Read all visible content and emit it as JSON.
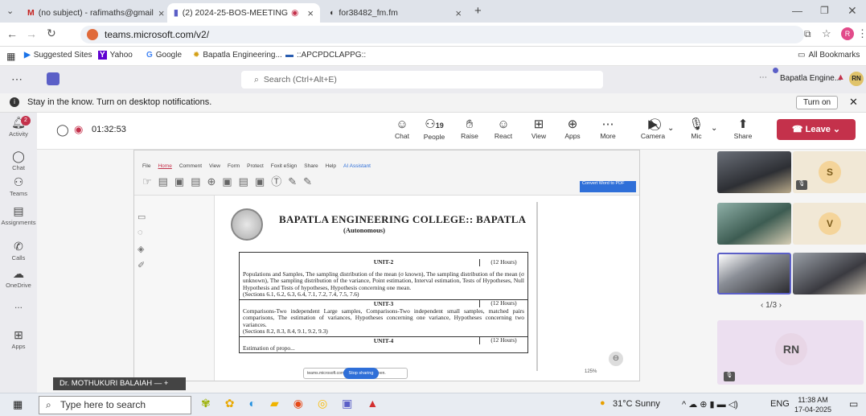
{
  "browser": {
    "tabs": [
      {
        "label": "(no subject) - rafimaths@gmail",
        "icon": "gmail-icon"
      },
      {
        "label": "(2) 2024-25-BOS-MEETING",
        "icon": "teams-icon"
      },
      {
        "label": "for38482_fm.fm",
        "icon": "web-icon"
      }
    ],
    "new_tab": "+",
    "url": "teams.microsoft.com/v2/",
    "bookmarks": [
      "Suggested Sites",
      "Yahoo",
      "Google",
      "Bapatla Engineering...",
      "::APCPDCLAPPG::"
    ],
    "all_bookmarks": "All Bookmarks",
    "profile_initial": "R"
  },
  "teams": {
    "search_placeholder": "Search (Ctrl+Alt+E)",
    "org": "Bapatla Engine...",
    "user_initials": "RN",
    "notification": "Stay in the know. Turn on desktop notifications.",
    "turn_on": "Turn on",
    "activity_badge": "2",
    "rail": [
      "Activity",
      "Chat",
      "Teams",
      "Assignments",
      "Calls",
      "OneDrive",
      "...",
      "Apps"
    ]
  },
  "meeting": {
    "timer": "01:32:53",
    "controls": [
      {
        "label": "Chat",
        "icon": "chat-icon"
      },
      {
        "label": "People",
        "icon": "people-icon",
        "count": "19"
      },
      {
        "label": "Raise",
        "icon": "raise-hand-icon"
      },
      {
        "label": "React",
        "icon": "react-icon"
      },
      {
        "label": "View",
        "icon": "view-icon"
      },
      {
        "label": "Apps",
        "icon": "apps-icon"
      },
      {
        "label": "More",
        "icon": "more-icon"
      }
    ],
    "camera": "Camera",
    "mic": "Mic",
    "share": "Share",
    "leave": "Leave",
    "presenter": "Dr. MOTHUKURI BALAIAH",
    "page_indicator": "1/3",
    "participant_initials": [
      "S",
      "V",
      "RN"
    ]
  },
  "shared_doc": {
    "menu": [
      "File",
      "Home",
      "Comment",
      "View",
      "Form",
      "Protect",
      "Foxit eSign",
      "Share",
      "Help",
      "AI Assistant"
    ],
    "convert_label": "Convert Word to PDF",
    "college": "BAPATLA ENGINEERING COLLEGE:: BAPATLA",
    "autonomous": "(Autonomous)",
    "units": [
      {
        "title": "UNIT-2",
        "hours": "(12 Hours)",
        "text": "Populations and Samples, The sampling distribution of the mean (σ known), The sampling distribution of the mean (σ unknown), The sampling distribution of the variance, Point estimation, Interval estimation, Tests of Hypotheses, Null Hypothesis and Tests of hypotheses, Hypothesis concerning one mean.",
        "sections": "(Sections 6.1, 6.2, 6.3, 6.4, 7.1, 7.2, 7.4, 7.5, 7.6)"
      },
      {
        "title": "UNIT-3",
        "hours": "(12 Hours)",
        "text": "Comparisons-Two independent Large samples, Comparisons-Two independent small samples, matched pairs comparisons, The estimation of variances, Hypotheses concerning one variance, Hypotheses concerning two variances.",
        "sections": "(Sections 8.2, 8.3, 8.4, 9.1, 9.2, 9.3)"
      },
      {
        "title": "UNIT-4",
        "hours": "(12 Hours)",
        "text": "Estimation of propo...",
        "sections": ""
      }
    ],
    "sharing_notice": "teams.microsoft.com is sharing your screen.",
    "stop_sharing": "Stop sharing",
    "zoom": "125%"
  },
  "taskbar": {
    "search": "Type here to search",
    "weather": "31°C  Sunny",
    "lang": "ENG",
    "time": "11:38 AM",
    "date": "17-04-2025"
  }
}
